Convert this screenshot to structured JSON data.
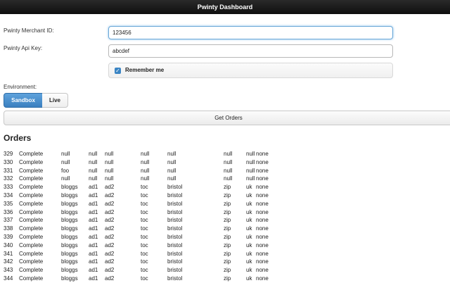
{
  "header": {
    "title": "Pwinty Dashboard"
  },
  "form": {
    "merchant_label": "Pwinty Merchant ID:",
    "merchant_value": "123456",
    "api_label": "Pwinty Api Key:",
    "api_value": "abcdef",
    "remember_label": "Remember me",
    "remember_checked": true,
    "environment_label": "Environment:",
    "env_options": [
      "Sandbox",
      "Live"
    ],
    "env_selected": "Sandbox",
    "get_orders_label": "Get Orders"
  },
  "orders": {
    "title": "Orders",
    "rows": [
      [
        "329",
        "Complete",
        "null",
        "null",
        "null",
        "null",
        "null",
        "null",
        "null",
        "none"
      ],
      [
        "330",
        "Complete",
        "null",
        "null",
        "null",
        "null",
        "null",
        "null",
        "null",
        "none"
      ],
      [
        "331",
        "Complete",
        "foo",
        "null",
        "null",
        "null",
        "null",
        "null",
        "null",
        "none"
      ],
      [
        "332",
        "Complete",
        "null",
        "null",
        "null",
        "null",
        "null",
        "null",
        "null",
        "none"
      ],
      [
        "333",
        "Complete",
        "bloggs",
        "ad1",
        "ad2",
        "toc",
        "bristol",
        "zip",
        "uk",
        "none"
      ],
      [
        "334",
        "Complete",
        "bloggs",
        "ad1",
        "ad2",
        "toc",
        "bristol",
        "zip",
        "uk",
        "none"
      ],
      [
        "335",
        "Complete",
        "bloggs",
        "ad1",
        "ad2",
        "toc",
        "bristol",
        "zip",
        "uk",
        "none"
      ],
      [
        "336",
        "Complete",
        "bloggs",
        "ad1",
        "ad2",
        "toc",
        "bristol",
        "zip",
        "uk",
        "none"
      ],
      [
        "337",
        "Complete",
        "bloggs",
        "ad1",
        "ad2",
        "toc",
        "bristol",
        "zip",
        "uk",
        "none"
      ],
      [
        "338",
        "Complete",
        "bloggs",
        "ad1",
        "ad2",
        "toc",
        "bristol",
        "zip",
        "uk",
        "none"
      ],
      [
        "339",
        "Complete",
        "bloggs",
        "ad1",
        "ad2",
        "toc",
        "bristol",
        "zip",
        "uk",
        "none"
      ],
      [
        "340",
        "Complete",
        "bloggs",
        "ad1",
        "ad2",
        "toc",
        "bristol",
        "zip",
        "uk",
        "none"
      ],
      [
        "341",
        "Complete",
        "bloggs",
        "ad1",
        "ad2",
        "toc",
        "bristol",
        "zip",
        "uk",
        "none"
      ],
      [
        "342",
        "Complete",
        "bloggs",
        "ad1",
        "ad2",
        "toc",
        "bristol",
        "zip",
        "uk",
        "none"
      ],
      [
        "343",
        "Complete",
        "bloggs",
        "ad1",
        "ad2",
        "toc",
        "bristol",
        "zip",
        "uk",
        "none"
      ],
      [
        "344",
        "Complete",
        "bloggs",
        "ad1",
        "ad2",
        "toc",
        "bristol",
        "zip",
        "uk",
        "none"
      ]
    ]
  }
}
